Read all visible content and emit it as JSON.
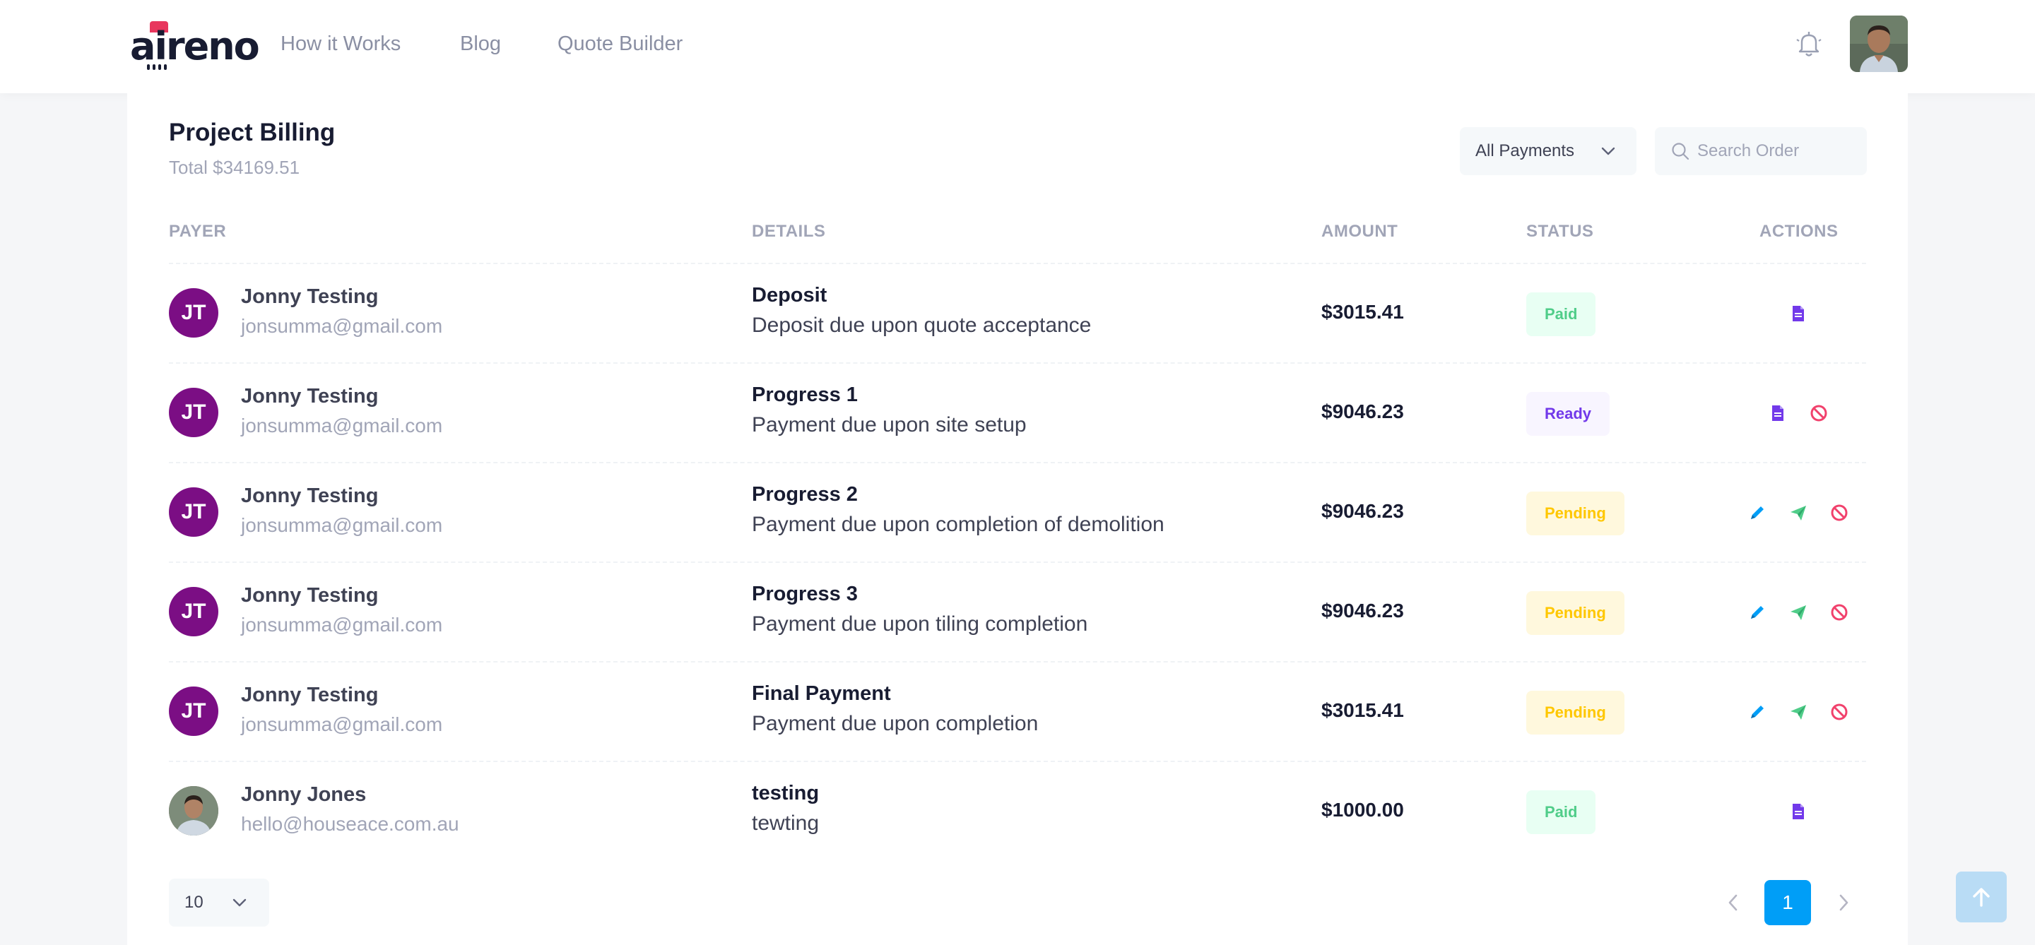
{
  "brand": {
    "logo_text": "aireno",
    "accent": "#e8365d"
  },
  "nav": {
    "items": [
      "How it Works",
      "Blog",
      "Quote Builder"
    ]
  },
  "header": {
    "notification_icon": "bell-icon",
    "avatar": "user-avatar"
  },
  "billing": {
    "title": "Project Billing",
    "total": "Total $34169.51",
    "filter": {
      "selected": "All Payments"
    },
    "search": {
      "placeholder": "Search Order",
      "value": ""
    },
    "columns": [
      "PAYER",
      "DETAILS",
      "AMOUNT",
      "STATUS",
      "ACTIONS"
    ],
    "rows": [
      {
        "initials": "JT",
        "name": "Jonny Testing",
        "email": "jonsumma@gmail.com",
        "detail_title": "Deposit",
        "detail_desc": "Deposit due upon quote acceptance",
        "amount": "$3015.41",
        "status": "Paid",
        "actions": [
          "invoice"
        ]
      },
      {
        "initials": "JT",
        "name": "Jonny Testing",
        "email": "jonsumma@gmail.com",
        "detail_title": "Progress 1",
        "detail_desc": "Payment due upon site setup",
        "amount": "$9046.23",
        "status": "Ready",
        "actions": [
          "invoice",
          "cancel"
        ]
      },
      {
        "initials": "JT",
        "name": "Jonny Testing",
        "email": "jonsumma@gmail.com",
        "detail_title": "Progress 2",
        "detail_desc": "Payment due upon completion of demolition",
        "amount": "$9046.23",
        "status": "Pending",
        "actions": [
          "edit",
          "send",
          "cancel"
        ]
      },
      {
        "initials": "JT",
        "name": "Jonny Testing",
        "email": "jonsumma@gmail.com",
        "detail_title": "Progress 3",
        "detail_desc": "Payment due upon tiling completion",
        "amount": "$9046.23",
        "status": "Pending",
        "actions": [
          "edit",
          "send",
          "cancel"
        ]
      },
      {
        "initials": "JT",
        "name": "Jonny Testing",
        "email": "jonsumma@gmail.com",
        "detail_title": "Final Payment",
        "detail_desc": "Payment due upon completion",
        "amount": "$3015.41",
        "status": "Pending",
        "actions": [
          "edit",
          "send",
          "cancel"
        ]
      },
      {
        "initials": "",
        "name": "Jonny Jones",
        "email": "hello@houseace.com.au",
        "detail_title": "testing",
        "detail_desc": "tewting",
        "amount": "$1000.00",
        "status": "Paid",
        "actions": [
          "invoice"
        ]
      }
    ]
  },
  "pagination": {
    "page_size": "10",
    "current_page": "1"
  },
  "colors": {
    "primary": "#009ef7",
    "paid": "#50cd89",
    "ready": "#7239ea",
    "pending": "#ffc700",
    "danger": "#f1416c",
    "avatar_bg": "#7b0e84"
  }
}
